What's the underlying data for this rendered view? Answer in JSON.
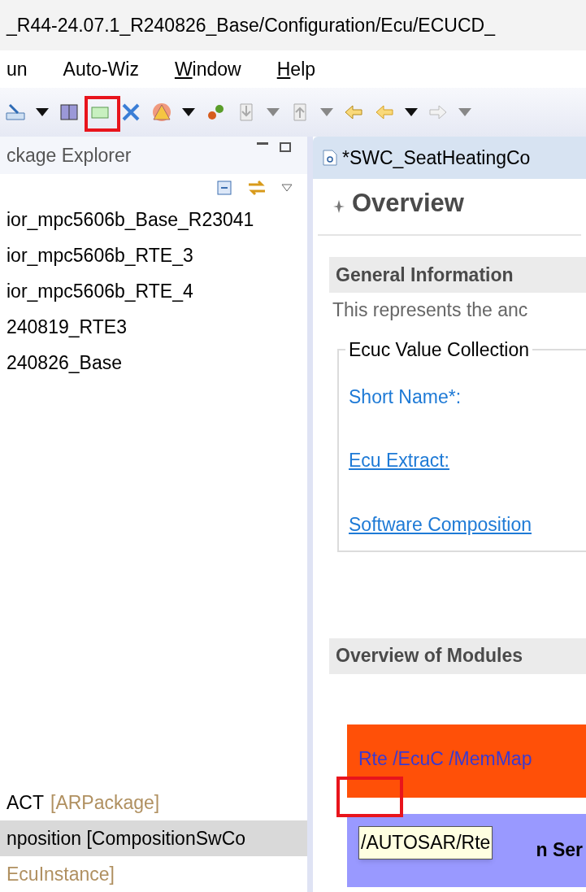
{
  "window": {
    "title": "_R44-24.07.1_R240826_Base/Configuration/Ecu/ECUCD_"
  },
  "menu": [
    {
      "label": "un",
      "mnemonic": false
    },
    {
      "label": "Auto-Wiz",
      "mnemonic": false
    },
    {
      "label": "Window",
      "mnemonic": true
    },
    {
      "label": "Help",
      "mnemonic": true
    }
  ],
  "explorer": {
    "title": "ckage Explorer",
    "items": [
      {
        "name": "ior_mpc5606b_Base_R23041",
        "selected": false
      },
      {
        "name": "ior_mpc5606b_RTE_3",
        "selected": false
      },
      {
        "name": "ior_mpc5606b_RTE_4",
        "selected": false
      },
      {
        "name": "240819_RTE3",
        "selected": false
      },
      {
        "name": "240826_Base",
        "selected": false
      }
    ],
    "bottom_items": [
      {
        "name": "ACT",
        "type": "[ARPackage]",
        "selected": false
      },
      {
        "name": "nposition [CompositionSwCo",
        "selected": true
      },
      {
        "type": "EcuInstance]",
        "selected": false
      }
    ]
  },
  "editor": {
    "tab": "*SWC_SeatHeatingCo",
    "heading": "Overview",
    "general_section": "General Information",
    "description": "This represents the anc",
    "group": {
      "title": "Ecuc Value Collection",
      "fields": [
        {
          "label": "Short Name*:",
          "link": false
        },
        {
          "label": "Ecu Extract:",
          "link": true
        },
        {
          "label": "Software Composition",
          "link": true
        }
      ]
    },
    "modules_section": "Overview of Modules",
    "modules": [
      {
        "color": "#ff5008",
        "text": "Rte /EcuC /MemMap"
      },
      {
        "color": "#9999ff",
        "text": "n Ser"
      }
    ],
    "tooltip": "/AUTOSAR/Rte"
  }
}
